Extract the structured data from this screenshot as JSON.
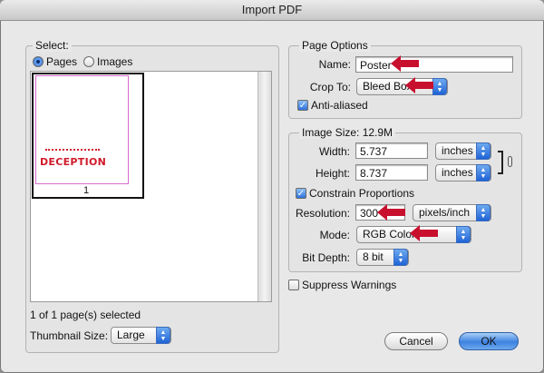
{
  "window": {
    "title": "Import PDF"
  },
  "select": {
    "legend": "Select:",
    "radio_pages": "Pages",
    "radio_images": "Images",
    "thumbnail_page_number": "1",
    "thumbnail_text": "DECEPTION",
    "status": "1 of 1 page(s) selected",
    "thumbnail_size_label": "Thumbnail Size:",
    "thumbnail_size_value": "Large"
  },
  "page_options": {
    "legend": "Page Options",
    "name_label": "Name:",
    "name_value": "Poster",
    "crop_label": "Crop To:",
    "crop_value": "Bleed Box",
    "anti_aliased_label": "Anti-aliased"
  },
  "image_size": {
    "legend": "Image Size: 12.9M",
    "width_label": "Width:",
    "width_value": "5.737",
    "width_unit": "inches",
    "height_label": "Height:",
    "height_value": "8.737",
    "height_unit": "inches",
    "constrain_label": "Constrain Proportions",
    "resolution_label": "Resolution:",
    "resolution_value": "300",
    "resolution_unit": "pixels/inch",
    "mode_label": "Mode:",
    "mode_value": "RGB Color",
    "bitdepth_label": "Bit Depth:",
    "bitdepth_value": "8 bit"
  },
  "suppress_label": "Suppress Warnings",
  "buttons": {
    "cancel": "Cancel",
    "ok": "OK"
  },
  "colors": {
    "accent_blue": "#2f72db",
    "annotation_red": "#c8102e",
    "thumbnail_text": "#d11a2a"
  }
}
